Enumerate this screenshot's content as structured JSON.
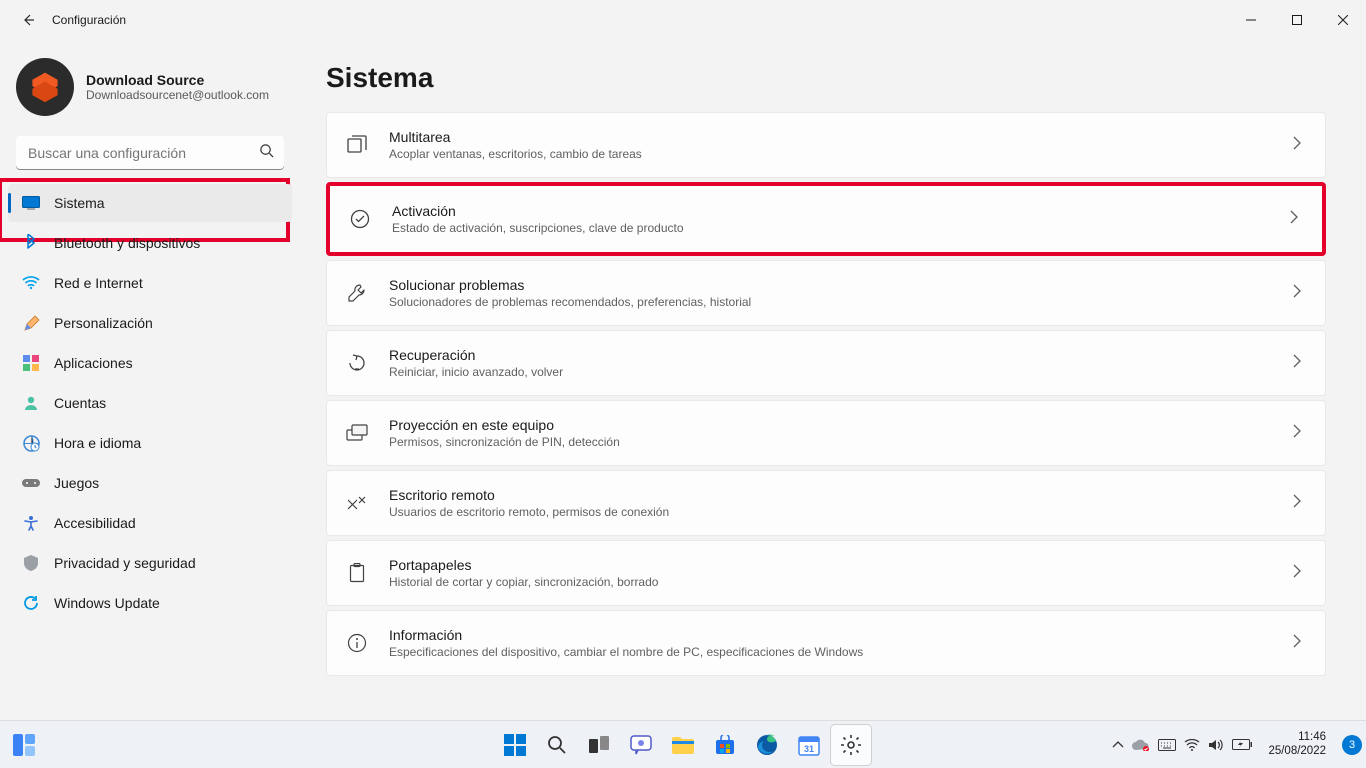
{
  "window": {
    "app_title": "Configuración"
  },
  "profile": {
    "name": "Download Source",
    "email": "Downloadsourcenet@outlook.com"
  },
  "search": {
    "placeholder": "Buscar una configuración"
  },
  "sidebar": {
    "items": [
      {
        "label": "Sistema",
        "icon": "system-icon"
      },
      {
        "label": "Bluetooth y dispositivos",
        "icon": "bluetooth-icon"
      },
      {
        "label": "Red e Internet",
        "icon": "wifi-icon"
      },
      {
        "label": "Personalización",
        "icon": "personalization-icon"
      },
      {
        "label": "Aplicaciones",
        "icon": "apps-icon"
      },
      {
        "label": "Cuentas",
        "icon": "accounts-icon"
      },
      {
        "label": "Hora e idioma",
        "icon": "time-language-icon"
      },
      {
        "label": "Juegos",
        "icon": "gaming-icon"
      },
      {
        "label": "Accesibilidad",
        "icon": "accessibility-icon"
      },
      {
        "label": "Privacidad y seguridad",
        "icon": "privacy-icon"
      },
      {
        "label": "Windows Update",
        "icon": "update-icon"
      }
    ]
  },
  "page": {
    "title": "Sistema",
    "items": [
      {
        "title": "Multitarea",
        "desc": "Acoplar ventanas, escritorios, cambio de tareas"
      },
      {
        "title": "Activación",
        "desc": "Estado de activación, suscripciones, clave de producto"
      },
      {
        "title": "Solucionar problemas",
        "desc": "Solucionadores de problemas recomendados, preferencias, historial"
      },
      {
        "title": "Recuperación",
        "desc": "Reiniciar, inicio avanzado, volver"
      },
      {
        "title": "Proyección en este equipo",
        "desc": "Permisos, sincronización de PIN, detección"
      },
      {
        "title": "Escritorio remoto",
        "desc": "Usuarios de escritorio remoto, permisos de conexión"
      },
      {
        "title": "Portapapeles",
        "desc": "Historial de cortar y copiar, sincronización, borrado"
      },
      {
        "title": "Información",
        "desc": "Especificaciones del dispositivo, cambiar el nombre de PC, especificaciones de Windows"
      }
    ]
  },
  "taskbar": {
    "time": "11:46",
    "date": "25/08/2022",
    "notification_count": "3"
  }
}
